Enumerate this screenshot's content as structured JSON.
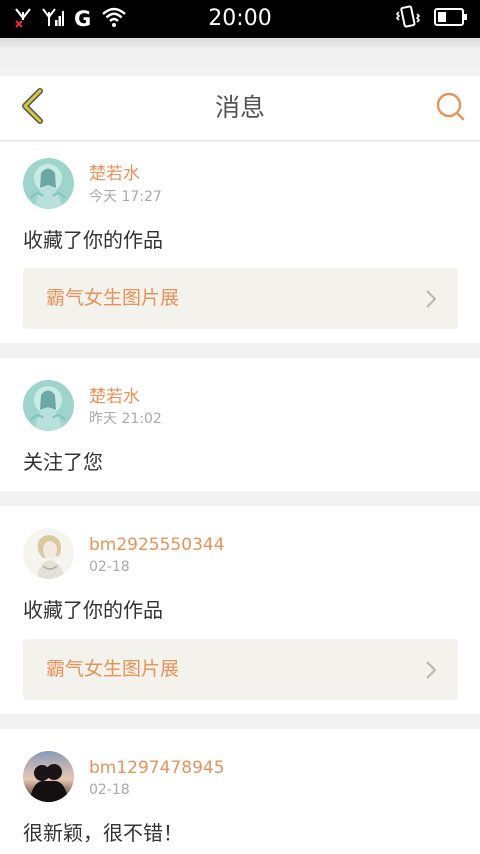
{
  "status_bar": {
    "time": "20:00",
    "network": "G",
    "icons": [
      "signal-off-icon",
      "signal-icon",
      "wifi-icon",
      "vibrate-icon",
      "battery-icon"
    ]
  },
  "header": {
    "title": "消息",
    "back_icon": "chevron-left-icon",
    "search_icon": "search-icon"
  },
  "colors": {
    "accent": "#e8935a",
    "back_icon": "#c9c13a",
    "card_bg": "#ffffff",
    "page_bg": "#f2f2f2",
    "link_bg": "#f3f2ec"
  },
  "messages": [
    {
      "user": "楚若水",
      "time": "今天 17:27",
      "text": "收藏了你的作品",
      "work": "霸气女生图片展"
    },
    {
      "user": "楚若水",
      "time": "昨天 21:02",
      "text": "关注了您"
    },
    {
      "user": "bm2925550344",
      "time": "02-18",
      "text": "收藏了你的作品",
      "work": "霸气女生图片展"
    },
    {
      "user": "bm1297478945",
      "time": "02-18",
      "text": "很新颖，很不错！"
    }
  ]
}
